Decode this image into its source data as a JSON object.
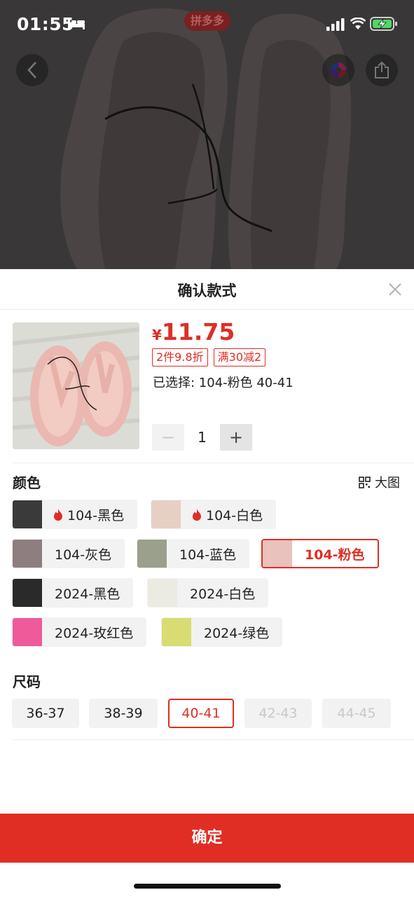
{
  "status_bar": {
    "time": "01:55",
    "icons": [
      "bed-icon",
      "signal-icon",
      "wifi-icon",
      "battery-charging-icon"
    ]
  },
  "hero": {
    "brand_badge": "拼多多",
    "icons": [
      "back-icon",
      "brand-swirl-icon",
      "share-icon"
    ]
  },
  "sheet": {
    "title": "确认款式",
    "price_currency": "¥",
    "price": "11.75",
    "promo_tags": [
      "2件9.8折",
      "满30减2"
    ],
    "selected_label": "已选择: 104-粉色 40-41",
    "quantity": "1",
    "minus_label": "−",
    "plus_label": "+"
  },
  "color_section": {
    "title": "颜色",
    "big_picture_label": "大图",
    "options": [
      {
        "label": "104-黑色",
        "hot": true,
        "selected": false,
        "swatch": "#3a3a3a"
      },
      {
        "label": "104-白色",
        "hot": true,
        "selected": false,
        "swatch": "#e7cfc4"
      },
      {
        "label": "104-灰色",
        "hot": false,
        "selected": false,
        "swatch": "#8f7e80"
      },
      {
        "label": "104-蓝色",
        "hot": false,
        "selected": false,
        "swatch": "#9aa08c"
      },
      {
        "label": "104-粉色",
        "hot": false,
        "selected": true,
        "swatch": "#e9c1bd"
      },
      {
        "label": "2024-黑色",
        "hot": false,
        "selected": false,
        "swatch": "#2a2a2a"
      },
      {
        "label": "2024-白色",
        "hot": false,
        "selected": false,
        "swatch": "#ecebe2"
      },
      {
        "label": "2024-玫红色",
        "hot": false,
        "selected": false,
        "swatch": "#ee5a9a"
      },
      {
        "label": "2024-绿色",
        "hot": false,
        "selected": false,
        "swatch": "#d8dc73"
      }
    ]
  },
  "size_section": {
    "title": "尺码",
    "options": [
      {
        "label": "36-37",
        "state": "normal"
      },
      {
        "label": "38-39",
        "state": "normal"
      },
      {
        "label": "40-41",
        "state": "selected"
      },
      {
        "label": "42-43",
        "state": "disabled"
      },
      {
        "label": "44-45",
        "state": "disabled"
      }
    ]
  },
  "confirm_label": "确定",
  "colors": {
    "accent": "#e02e24",
    "chip_bg": "#f2f2f2",
    "overlay": "#3a3838"
  }
}
